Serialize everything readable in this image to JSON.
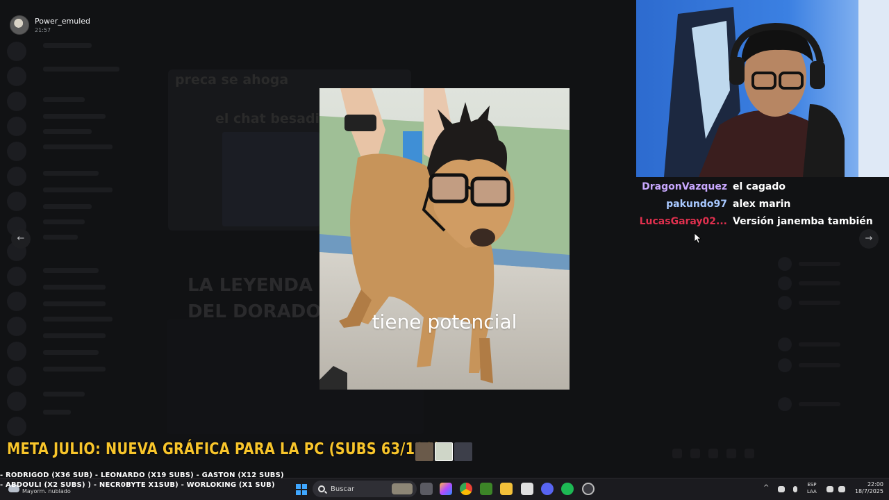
{
  "viewer": {
    "user": "Power_emuled",
    "time": "21:57",
    "prev_label": "←",
    "next_label": "→",
    "caption": "tiene potencial"
  },
  "background": {
    "card_title": "preca se ahoga",
    "card_subtitle": "el chat besadi",
    "leyenda_line1": "LA LEYENDA",
    "leyenda_line2": "DEL DORADO"
  },
  "chat": [
    {
      "user": "DragonVazquez",
      "message": "el cagado",
      "color": "#c9a8ff"
    },
    {
      "user": "pakundo97",
      "message": "alex marin",
      "color": "#a8c8ff"
    },
    {
      "user": "LucasGaray02...",
      "message": "Versión janemba también",
      "color": "#e0304e"
    }
  ],
  "overlay": {
    "goal": "META JULIO: NUEVA GRÁFICA PARA LA PC (SUBS 63/100)",
    "subs_line1": "- RODRIGOD (X36 SUB)  - LEONARDO (X19 SUBS) - GASTON (X12 SUBS)",
    "subs_line2": "- ABDOULI (X2 SUBS) ) - NECR0BYTE X1SUB) - WORLOKING (X1 SUB)"
  },
  "taskbar": {
    "weather": "Mayorm. nublado",
    "search_placeholder": "Buscar",
    "lang_line1": "ESP",
    "lang_line2": "LAA",
    "clock_time": "22:00",
    "clock_date": "18/7/2025"
  },
  "colors": {
    "goal": "#f8c52b",
    "accent_windows": "#3fa7ff"
  }
}
